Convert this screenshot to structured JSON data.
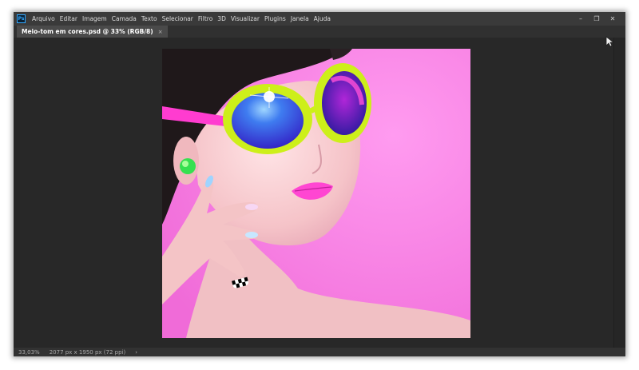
{
  "app": {
    "logo_text": "Ps",
    "menu": [
      "Arquivo",
      "Editar",
      "Imagem",
      "Camada",
      "Texto",
      "Selecionar",
      "Filtro",
      "3D",
      "Visualizar",
      "Plugins",
      "Janela",
      "Ajuda"
    ],
    "window_controls": {
      "minimize": "–",
      "restore": "❐",
      "close": "✕"
    }
  },
  "document": {
    "tab_title": "Meio-tom em cores.psd @ 33% (RGB/8)",
    "tab_close": "×"
  },
  "status": {
    "zoom": "33,03%",
    "dimensions": "2077 px x 1950 px (72 ppi)",
    "arrow": "›"
  },
  "colors": {
    "background_magenta": "#ff7ee6",
    "frame_yellow_green": "#c8f01a",
    "lens_blue": "#3a40e0",
    "lips_pink": "#ff4fd0",
    "skin": "#f3c6c6",
    "hair": "#221a1c"
  }
}
